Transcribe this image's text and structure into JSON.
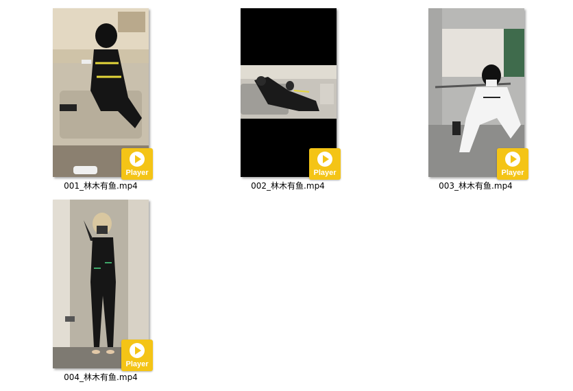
{
  "files": [
    {
      "name": "001_林木有鱼.mp4",
      "type": "video-file",
      "badge": {
        "label": "Player",
        "icon": "play-icon",
        "color": "#f4c416"
      }
    },
    {
      "name": "002_林木有鱼.mp4",
      "type": "video-file",
      "badge": {
        "label": "Player",
        "icon": "play-icon",
        "color": "#f4c416"
      }
    },
    {
      "name": "003_林木有鱼.mp4",
      "type": "video-file",
      "badge": {
        "label": "Player",
        "icon": "play-icon",
        "color": "#f4c416"
      }
    },
    {
      "name": "004_林木有鱼.mp4",
      "type": "video-file",
      "badge": {
        "label": "Player",
        "icon": "play-icon",
        "color": "#f4c416"
      }
    }
  ]
}
